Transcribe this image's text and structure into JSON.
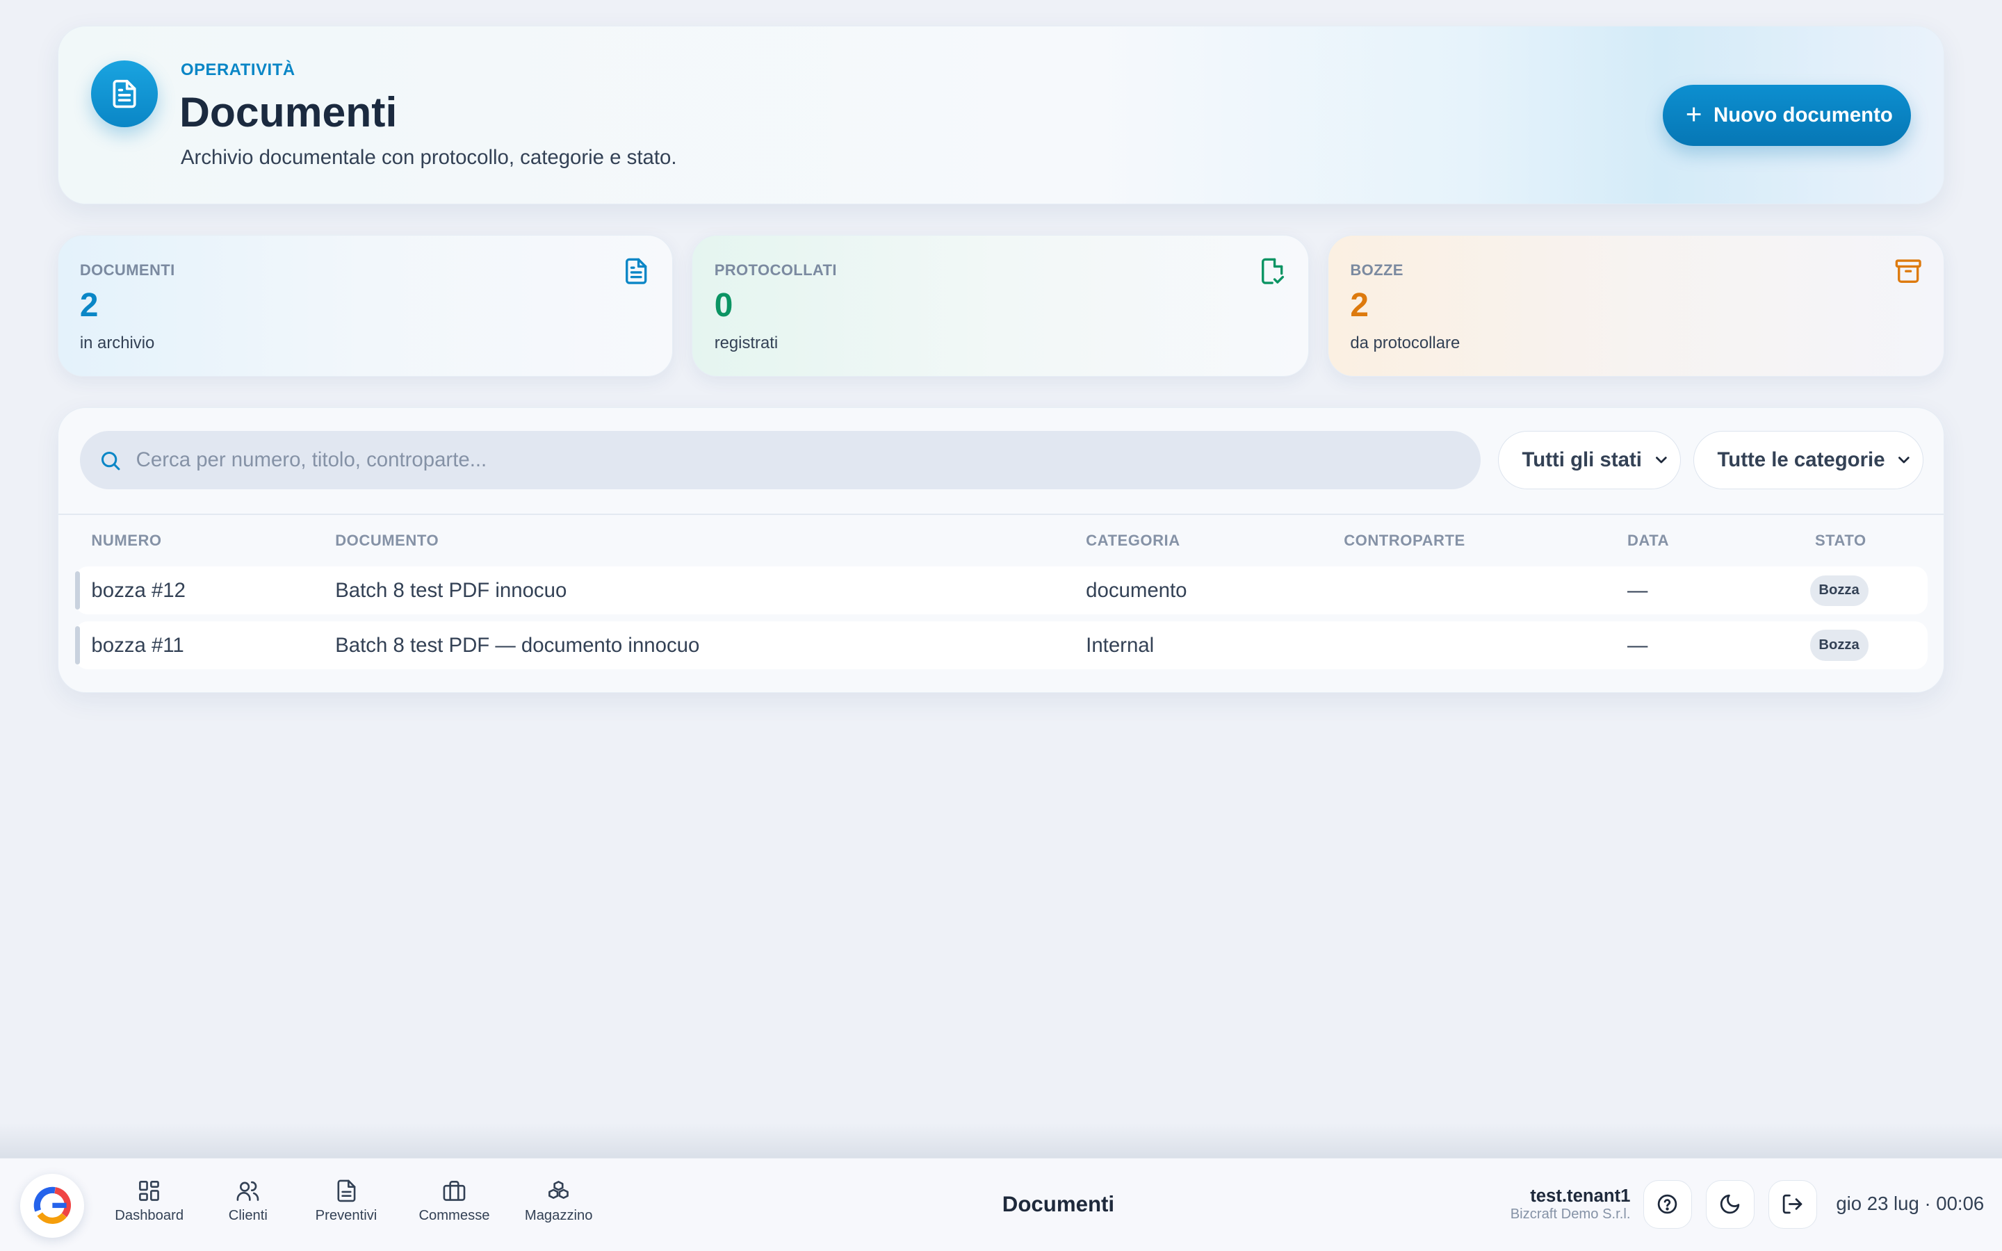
{
  "header": {
    "eyebrow": "OPERATIVITÀ",
    "title": "Documenti",
    "subtitle": "Archivio documentale con protocollo, categorie e stato.",
    "new_button_label": "Nuovo documento",
    "accent_color": "#0a86c6"
  },
  "stats": [
    {
      "label": "DOCUMENTI",
      "value": "2",
      "caption": "in archivio",
      "icon": "document-icon",
      "color": "#0a86c6"
    },
    {
      "label": "PROTOCOLLATI",
      "value": "0",
      "caption": "registrati",
      "icon": "file-check-icon",
      "color": "#0b9463"
    },
    {
      "label": "BOZZE",
      "value": "2",
      "caption": "da protocollare",
      "icon": "archive-icon",
      "color": "#dd7a0e"
    }
  ],
  "filters": {
    "search_placeholder": "Cerca per numero, titolo, controparte...",
    "status_selected": "Tutti gli stati",
    "category_selected": "Tutte le categorie"
  },
  "table": {
    "columns": [
      "NUMERO",
      "DOCUMENTO",
      "CATEGORIA",
      "CONTROPARTE",
      "DATA",
      "STATO"
    ],
    "rows": [
      {
        "numero": "bozza #12",
        "documento": "Batch 8 test PDF innocuo",
        "categoria": "documento",
        "controparte": "",
        "data": "—",
        "stato": "Bozza"
      },
      {
        "numero": "bozza #11",
        "documento": "Batch 8 test PDF — documento innocuo",
        "categoria": "Internal",
        "controparte": "",
        "data": "—",
        "stato": "Bozza"
      }
    ]
  },
  "dock": {
    "nav": [
      {
        "label": "Dashboard",
        "icon": "dashboard-icon"
      },
      {
        "label": "Clienti",
        "icon": "users-icon"
      },
      {
        "label": "Preventivi",
        "icon": "file-text-icon"
      },
      {
        "label": "Commesse",
        "icon": "briefcase-icon"
      },
      {
        "label": "Magazzino",
        "icon": "boxes-icon"
      }
    ],
    "current_page": "Documenti",
    "user_name": "test.tenant1",
    "company": "Bizcraft Demo S.r.l.",
    "datetime": "gio 23 lug · 00:06"
  }
}
